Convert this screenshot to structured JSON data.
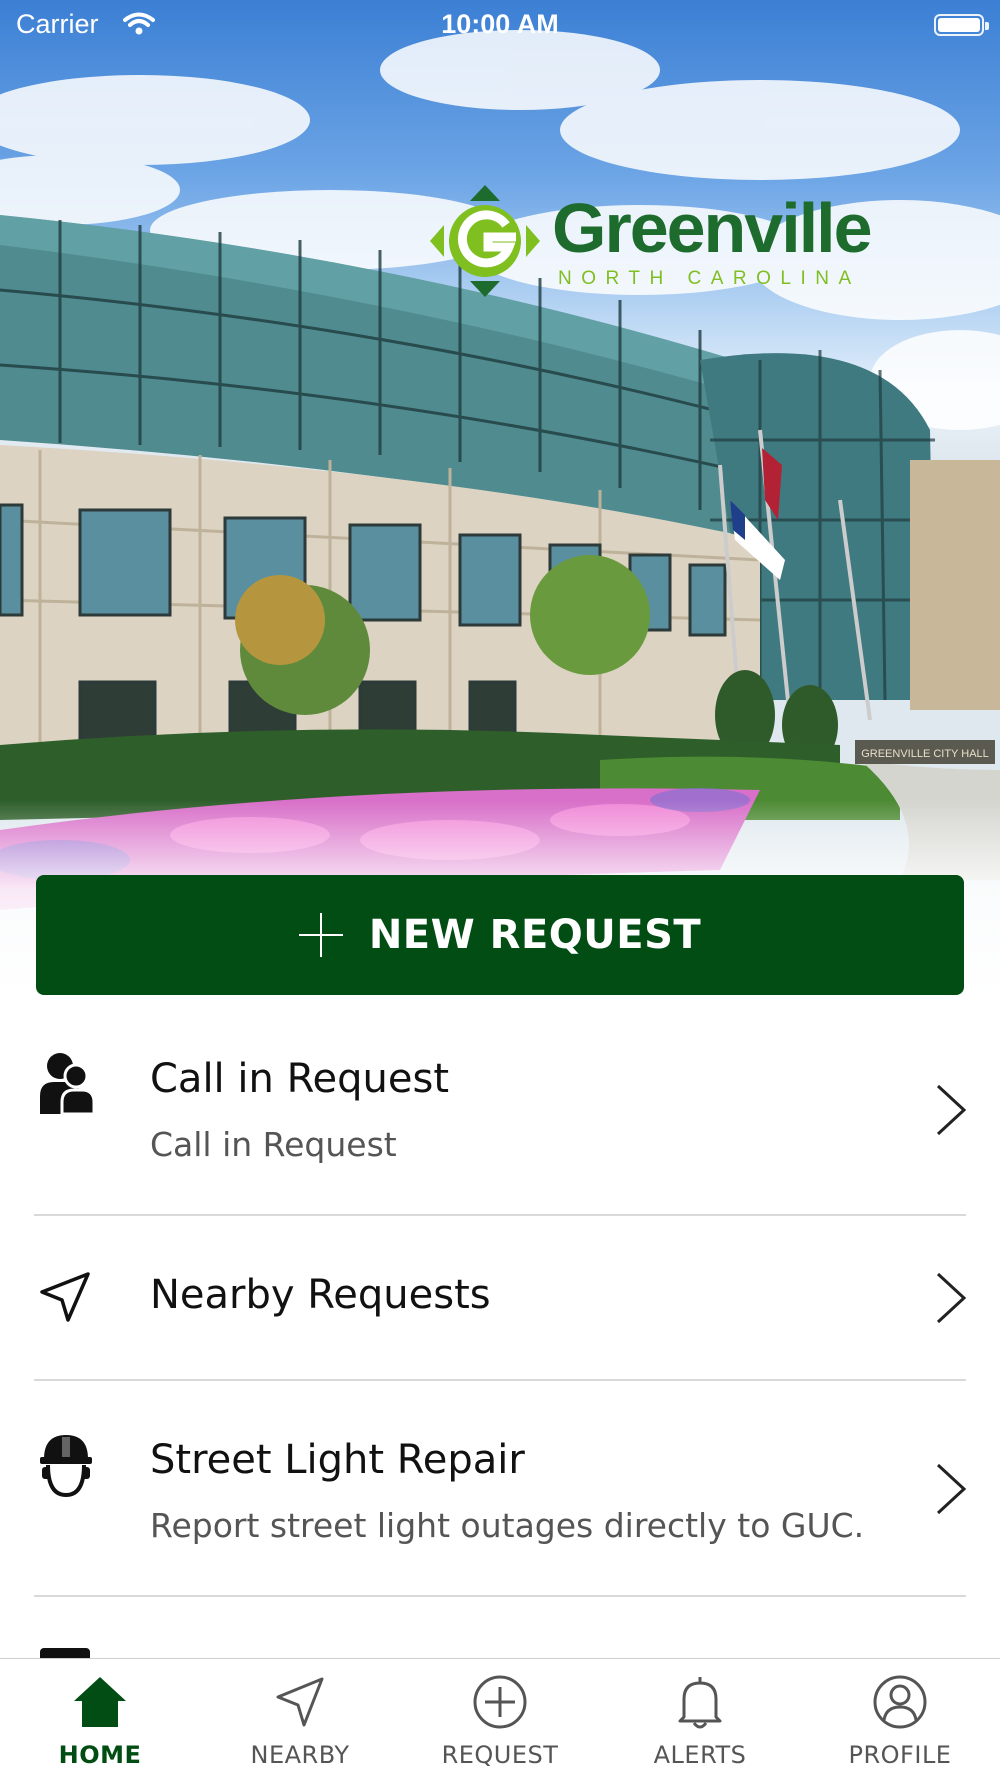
{
  "status_bar": {
    "carrier": "Carrier",
    "time": "10:00 AM"
  },
  "logo": {
    "wordmark": "Greenville",
    "subtitle": "NORTH CAROLINA",
    "sign_text": "GREENVILLE CITY HALL"
  },
  "colors": {
    "primary": "#024d13",
    "logo_green": "#1e6b2e",
    "logo_light_green": "#7fbf1f"
  },
  "new_request": {
    "label": "NEW REQUEST",
    "icon": "plus-icon"
  },
  "menu": [
    {
      "title": "Call in Request",
      "subtitle": "Call in Request",
      "icon": "people-icon"
    },
    {
      "title": "Nearby Requests",
      "subtitle": "",
      "icon": "location-arrow-icon"
    },
    {
      "title": "Street Light Repair",
      "subtitle": "Report street light outages directly to GUC.",
      "icon": "hardhat-worker-icon"
    }
  ],
  "tab_bar": {
    "active": "HOME",
    "tabs": [
      {
        "label": "HOME",
        "icon": "home-icon"
      },
      {
        "label": "NEARBY",
        "icon": "location-arrow-icon"
      },
      {
        "label": "REQUEST",
        "icon": "plus-circle-icon"
      },
      {
        "label": "ALERTS",
        "icon": "bell-icon"
      },
      {
        "label": "PROFILE",
        "icon": "user-circle-icon"
      }
    ]
  }
}
